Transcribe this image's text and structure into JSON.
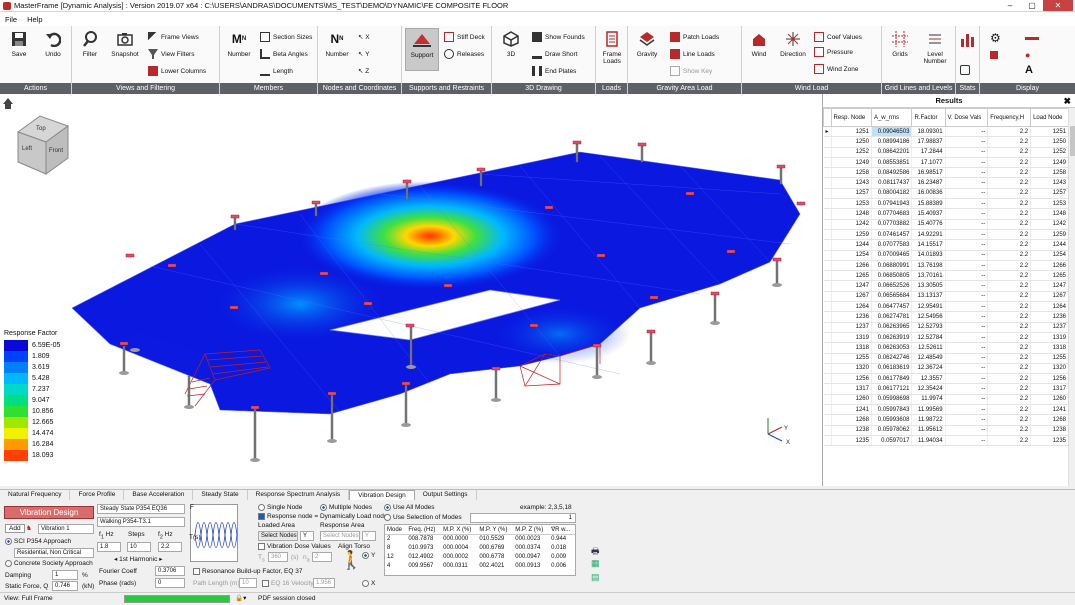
{
  "window": {
    "title": "MasterFrame [Dynamic Analysis] : Version 2019.07 x64 : C:\\USERS\\ANDRAS\\DOCUMENTS\\MS_TEST\\DEMO\\DYNAMIC\\FE COMPOSITE FLOOR"
  },
  "menu": [
    "File",
    "Help"
  ],
  "ribbon": {
    "actions": {
      "label": "Actions",
      "save": "Save",
      "undo": "Undo"
    },
    "views": {
      "label": "Views and Filtering",
      "filter": "Filter",
      "snapshot": "Snapshot",
      "frame_views": "Frame Views",
      "view_filters": "View Filters",
      "lower_columns": "Lower Columns"
    },
    "members": {
      "label": "Members",
      "number": "Number",
      "section_sizes": "Section Sizes",
      "beta_angles": "Beta Angles",
      "length": "Length"
    },
    "nodes": {
      "label": "Nodes and Coordinates",
      "number": "Number"
    },
    "supports": {
      "label": "Supports and Restraints",
      "support": "Support",
      "stiff_deck": "Stiff Deck",
      "releases": "Releases"
    },
    "drawing3d": {
      "label": "3D Drawing",
      "d3": "3D",
      "show_founds": "Show Founds",
      "draw_short": "Draw Short",
      "end_plates": "End Plates"
    },
    "loads": {
      "label": "Loads",
      "frame_loads": "Frame Loads"
    },
    "gravity": {
      "label": "Gravity Area Load",
      "gravity": "Gravity",
      "patch_loads": "Patch Loads",
      "line_loads": "Line Loads",
      "show_key": "Show Key"
    },
    "wind": {
      "label": "Wind Load",
      "wind": "Wind",
      "direction": "Direction",
      "coef_values": "Coef Values",
      "pressure": "Pressure",
      "wind_zone": "Wind Zone"
    },
    "grids": {
      "label": "Grid Lines and Levels",
      "grids": "Grids",
      "level_number": "Level Number"
    },
    "stats": {
      "label": "Stats"
    },
    "display": {
      "label": "Display"
    }
  },
  "legend": {
    "title": "Response Factor",
    "items": [
      {
        "value": "6.59E-05",
        "color": "#0a0ad8"
      },
      {
        "value": "1.809",
        "color": "#0040ff"
      },
      {
        "value": "3.619",
        "color": "#0080ff"
      },
      {
        "value": "5.428",
        "color": "#00b8ff"
      },
      {
        "value": "7.237",
        "color": "#00d8c8"
      },
      {
        "value": "9.047",
        "color": "#00e080"
      },
      {
        "value": "10.856",
        "color": "#30e030"
      },
      {
        "value": "12.665",
        "color": "#a0e800"
      },
      {
        "value": "14.474",
        "color": "#f0f000"
      },
      {
        "value": "16.284",
        "color": "#ff9a00"
      },
      {
        "value": "18.093",
        "color": "#ff4000"
      }
    ]
  },
  "viewcube": {
    "top": "Top",
    "left": "Left",
    "front": "Front"
  },
  "axes": {
    "x": "X",
    "y": "Y"
  },
  "results": {
    "title": "Results",
    "columns": [
      "Resp. Node",
      "A_w_rms",
      "R.Factor",
      "V. Dose Vals",
      "Frequency,H",
      "Load Node"
    ],
    "rows": [
      [
        "1251",
        "0.09046503",
        "18.09301",
        "--",
        "2.2",
        "1251"
      ],
      [
        "1250",
        "0.08994186",
        "17.98837",
        "--",
        "2.2",
        "1250"
      ],
      [
        "1252",
        "0.08642201",
        "17.2844",
        "--",
        "2.2",
        "1252"
      ],
      [
        "1249",
        "0.08553851",
        "17.1077",
        "--",
        "2.2",
        "1249"
      ],
      [
        "1258",
        "0.08492586",
        "16.98517",
        "--",
        "2.2",
        "1258"
      ],
      [
        "1243",
        "0.08117437",
        "16.23487",
        "--",
        "2.2",
        "1243"
      ],
      [
        "1257",
        "0.08004182",
        "16.00836",
        "--",
        "2.2",
        "1257"
      ],
      [
        "1253",
        "0.07941943",
        "15.88389",
        "--",
        "2.2",
        "1253"
      ],
      [
        "1248",
        "0.07704683",
        "15.40937",
        "--",
        "2.2",
        "1248"
      ],
      [
        "1242",
        "0.07703882",
        "15.40776",
        "--",
        "2.2",
        "1242"
      ],
      [
        "1259",
        "0.07461457",
        "14.92291",
        "--",
        "2.2",
        "1259"
      ],
      [
        "1244",
        "0.07077583",
        "14.15517",
        "--",
        "2.2",
        "1244"
      ],
      [
        "1254",
        "0.07009465",
        "14.01893",
        "--",
        "2.2",
        "1254"
      ],
      [
        "1266",
        "0.06880991",
        "13.76198",
        "--",
        "2.2",
        "1266"
      ],
      [
        "1265",
        "0.06850805",
        "13.70161",
        "--",
        "2.2",
        "1265"
      ],
      [
        "1247",
        "0.06652526",
        "13.30505",
        "--",
        "2.2",
        "1247"
      ],
      [
        "1267",
        "0.06565684",
        "13.13137",
        "--",
        "2.2",
        "1267"
      ],
      [
        "1264",
        "0.06477457",
        "12.95491",
        "--",
        "2.2",
        "1264"
      ],
      [
        "1236",
        "0.06274781",
        "12.54956",
        "--",
        "2.2",
        "1236"
      ],
      [
        "1237",
        "0.06263965",
        "12.52793",
        "--",
        "2.2",
        "1237"
      ],
      [
        "1319",
        "0.06263919",
        "12.52784",
        "--",
        "2.2",
        "1319"
      ],
      [
        "1318",
        "0.06263053",
        "12.52611",
        "--",
        "2.2",
        "1318"
      ],
      [
        "1255",
        "0.06242746",
        "12.48549",
        "--",
        "2.2",
        "1255"
      ],
      [
        "1320",
        "0.06183619",
        "12.36724",
        "--",
        "2.2",
        "1320"
      ],
      [
        "1256",
        "0.06177849",
        "12.3557",
        "--",
        "2.2",
        "1256"
      ],
      [
        "1317",
        "0.06177121",
        "12.35424",
        "--",
        "2.2",
        "1317"
      ],
      [
        "1260",
        "0.05998698",
        "11.9974",
        "--",
        "2.2",
        "1260"
      ],
      [
        "1241",
        "0.05997843",
        "11.99569",
        "--",
        "2.2",
        "1241"
      ],
      [
        "1268",
        "0.05993608",
        "11.98722",
        "--",
        "2.2",
        "1268"
      ],
      [
        "1238",
        "0.05978062",
        "11.95612",
        "--",
        "2.2",
        "1238"
      ],
      [
        "1235",
        "0.0597017",
        "11.94034",
        "--",
        "2.2",
        "1235"
      ]
    ]
  },
  "tabs": [
    "Natural Frequency",
    "Force Profile",
    "Base Acceleration",
    "Steady State",
    "Response Spectrum Analysis",
    "Vibration Design",
    "Output Settings"
  ],
  "vibration": {
    "title": "Vibration Design",
    "add": "Add",
    "vib_select": "Vibration 1",
    "sci_approach": "SCI P354 Approach",
    "residential": "Residential, Non Critical",
    "concrete": "Concrete Society Approach",
    "damping_label": "Damping",
    "damping_val": "1",
    "damping_unit": "%",
    "static_force_label": "Static Force, Q",
    "static_force_val": "0.746",
    "static_force_unit": "(kN)",
    "steady_state": "Steady State P354 EQ36",
    "walking": "Walking P354-T3.1",
    "f1_label": "f",
    "f1_sub": "1",
    "f1_unit": "Hz",
    "steps_label": "Steps",
    "f2_label": "f",
    "f2_sub": "2",
    "f2_unit": "Hz",
    "f1_val": "1.8",
    "steps_val": "10",
    "f2_val": "2.2",
    "first_harmonic": "1st Harmonic",
    "fourier_label": "Fourier Coeff",
    "fourier_val": "0.3706",
    "phase_label": "Phase (rads)",
    "phase_val": "0",
    "f_axis": "F",
    "t_axis": "T(s)",
    "single_node": "Single Node",
    "multiple_nodes": "Multiple Nodes",
    "response_eq": "Response node = Dynamically Load node",
    "loaded_area": "Loaded Area",
    "response_area": "Response Area",
    "select_nodes1": "Select Nodes",
    "y1": "Y",
    "select_nodes2": "Select Nodes",
    "y2": "Y",
    "vdv": "Vibration Dose Values",
    "ts_label": "T",
    "ts_sub": "s",
    "ts_val": "360",
    "ts_unit": "(s)",
    "na_label": "n",
    "na_sub": "a",
    "na_val": "2",
    "align_torso": "Align Torso",
    "torso_y": "Y",
    "torso_x": "X",
    "resonance": "Resonance Build-up Factor, EQ 37",
    "path_length_label": "Path Length (m)",
    "path_length_val": "10",
    "eq16": "EQ 16 Velocity",
    "eq16_val": "1.956",
    "use_all_modes": "Use All Modes",
    "use_selection": "Use Selection of Modes",
    "example": "example: 2,3,5,18",
    "selection_count": "1",
    "mode_columns": [
      "Mode",
      "Freq. (Hz)",
      "M.P. X (%)",
      "M.P. Y (%)",
      "M.P. Z (%)",
      "∇R w..."
    ],
    "mode_rows": [
      [
        "2",
        "008.7878",
        "000.0000",
        "010.5529",
        "000.0023",
        "0.944"
      ],
      [
        "8",
        "010.9973",
        "000.0004",
        "000.6769",
        "000.0374",
        "0.018"
      ],
      [
        "12",
        "012.4902",
        "000.0002",
        "000.6778",
        "000.0947",
        "0.009"
      ],
      [
        "4",
        "009.9567",
        "000.0311",
        "002.4021",
        "000.0913",
        "0.006"
      ]
    ]
  },
  "status": {
    "view": "View: Full Frame",
    "progress": 1.0,
    "message": "PDF session closed"
  }
}
